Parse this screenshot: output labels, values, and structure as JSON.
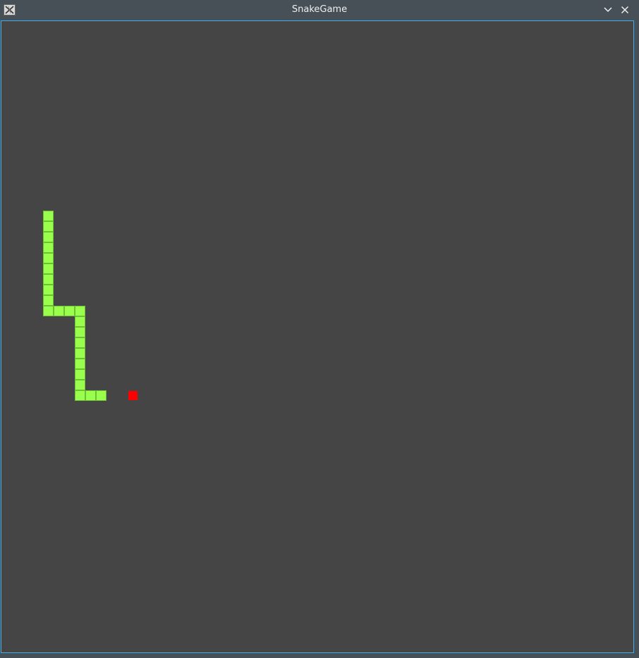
{
  "window": {
    "title": "SnakeGame",
    "app_icon": "x-window-icon",
    "minimize_icon": "chevron-down-icon",
    "close_icon": "close-icon"
  },
  "game": {
    "grid_cols": 60,
    "grid_rows": 60,
    "colors": {
      "background": "#454545",
      "snake": "#99ff4c",
      "food": "#ff0000",
      "frame_border": "#3daee9"
    },
    "snake": [
      [
        9,
        35
      ],
      [
        8,
        35
      ],
      [
        7,
        35
      ],
      [
        7,
        34
      ],
      [
        7,
        33
      ],
      [
        7,
        32
      ],
      [
        7,
        31
      ],
      [
        7,
        30
      ],
      [
        7,
        29
      ],
      [
        7,
        28
      ],
      [
        7,
        27
      ],
      [
        6,
        27
      ],
      [
        5,
        27
      ],
      [
        4,
        27
      ],
      [
        4,
        26
      ],
      [
        4,
        25
      ],
      [
        4,
        24
      ],
      [
        4,
        23
      ],
      [
        4,
        22
      ],
      [
        4,
        21
      ],
      [
        4,
        20
      ],
      [
        4,
        19
      ],
      [
        4,
        18
      ]
    ],
    "food": [
      12,
      35
    ]
  }
}
